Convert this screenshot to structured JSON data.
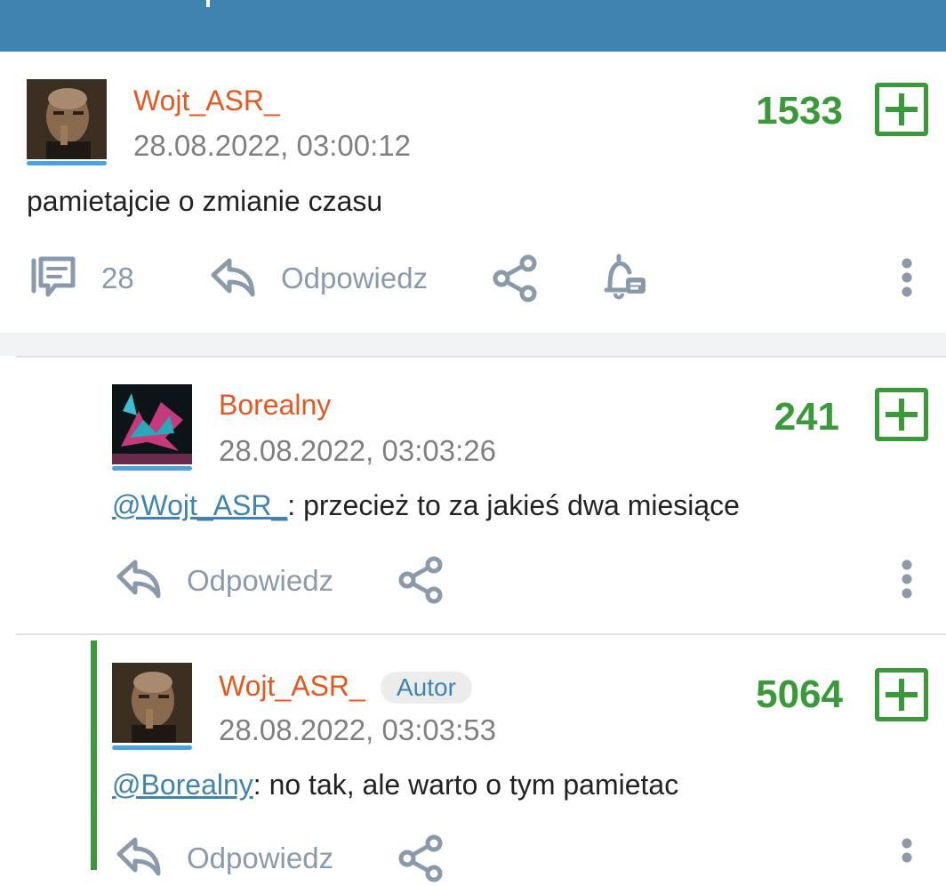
{
  "comments": [
    {
      "username": "Wojt_ASR_",
      "timestamp": "28.08.2022, 03:00:12",
      "score": "1533",
      "text": "pamietajcie o zmianie czasu",
      "reply_count": "28",
      "reply_label": "Odpowiedz"
    },
    {
      "username": "Borealny",
      "timestamp": "28.08.2022, 03:03:26",
      "score": "241",
      "mention": "@Wojt_ASR_",
      "text": ": przecież to za jakieś dwa miesiące",
      "reply_label": "Odpowiedz"
    },
    {
      "username": "Wojt_ASR_",
      "badge": "Autor",
      "timestamp": "28.08.2022, 03:03:53",
      "score": "5064",
      "mention": "@Borealny",
      "text": ": no tak, ale warto o tym pamietac",
      "reply_label": "Odpowiedz"
    }
  ],
  "colors": {
    "header": "#3f84b0",
    "username": "#e8581e",
    "score": "#3a9a3a",
    "action": "#8a9aab",
    "mention": "#3f84b0"
  },
  "icons": [
    "comments-icon",
    "reply-icon",
    "share-icon",
    "notify-icon",
    "more-icon",
    "plus-vote-icon"
  ]
}
